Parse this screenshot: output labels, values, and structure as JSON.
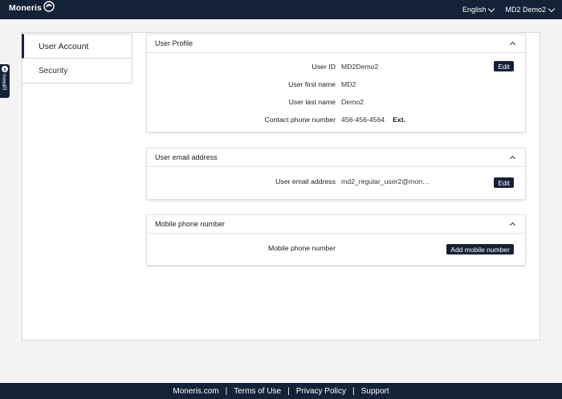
{
  "header": {
    "logo_text": "Moneris",
    "language": "English",
    "user": "MD2 Demo2"
  },
  "menu_tab": {
    "label": "Menu"
  },
  "sidebar": {
    "items": [
      {
        "label": "User Account"
      },
      {
        "label": "Security"
      }
    ]
  },
  "user_profile": {
    "title": "User Profile",
    "edit_label": "Edit",
    "fields": [
      {
        "label": "User ID",
        "value": "MD2Demo2"
      },
      {
        "label": "User first name",
        "value": "MD2"
      },
      {
        "label": "User last name",
        "value": "Demo2"
      },
      {
        "label": "Contact phone number",
        "value": "456-456-4564",
        "ext": "Ext."
      }
    ]
  },
  "email_section": {
    "title": "User email address",
    "label": "User email address",
    "value": "md2_regular_user2@mon…",
    "edit_label": "Edit"
  },
  "mobile_section": {
    "title": "Mobile phone number",
    "label": "Mobile phone number",
    "add_label": "Add mobile number"
  },
  "footer": {
    "links": [
      "Moneris.com",
      "Terms of Use",
      "Privacy Policy",
      "Support"
    ],
    "separator": "|"
  }
}
